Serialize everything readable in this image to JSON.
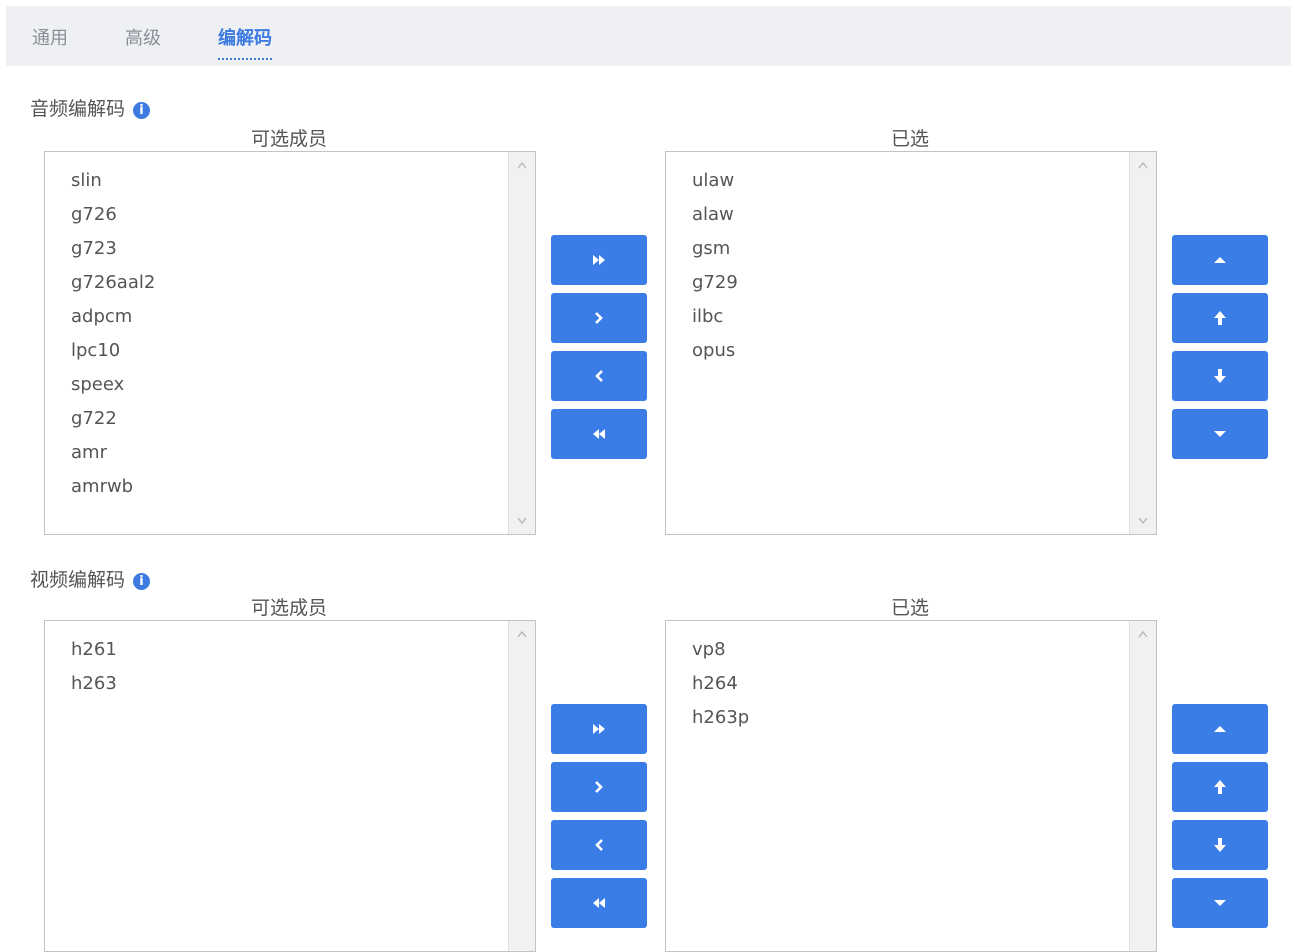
{
  "tabs": [
    {
      "label": "通用"
    },
    {
      "label": "高级"
    },
    {
      "label": "编解码"
    }
  ],
  "active_tab": "编解码",
  "accent_color": "#3a7de6",
  "audio": {
    "title": "音频编解码",
    "info_icon": "i",
    "available_header": "可选成员",
    "selected_header": "已选",
    "available": [
      "slin",
      "g726",
      "g723",
      "g726aal2",
      "adpcm",
      "lpc10",
      "speex",
      "g722",
      "amr",
      "amrwb"
    ],
    "selected": [
      "ulaw",
      "alaw",
      "gsm",
      "g729",
      "ilbc",
      "opus"
    ]
  },
  "video": {
    "title": "视频编解码",
    "info_icon": "i",
    "available_header": "可选成员",
    "selected_header": "已选",
    "available": [
      "h261",
      "h263"
    ],
    "selected": [
      "vp8",
      "h264",
      "h263p"
    ]
  },
  "icons": {
    "move_all_right": "double-chevron-right-icon",
    "move_right": "chevron-right-icon",
    "move_left": "chevron-left-icon",
    "move_all_left": "double-chevron-left-icon",
    "move_top": "caret-up-icon",
    "move_up": "arrow-up-icon",
    "move_down": "arrow-down-icon",
    "move_bottom": "caret-down-icon",
    "scroll_up": "scroll-up-icon",
    "scroll_down": "scroll-down-icon"
  }
}
